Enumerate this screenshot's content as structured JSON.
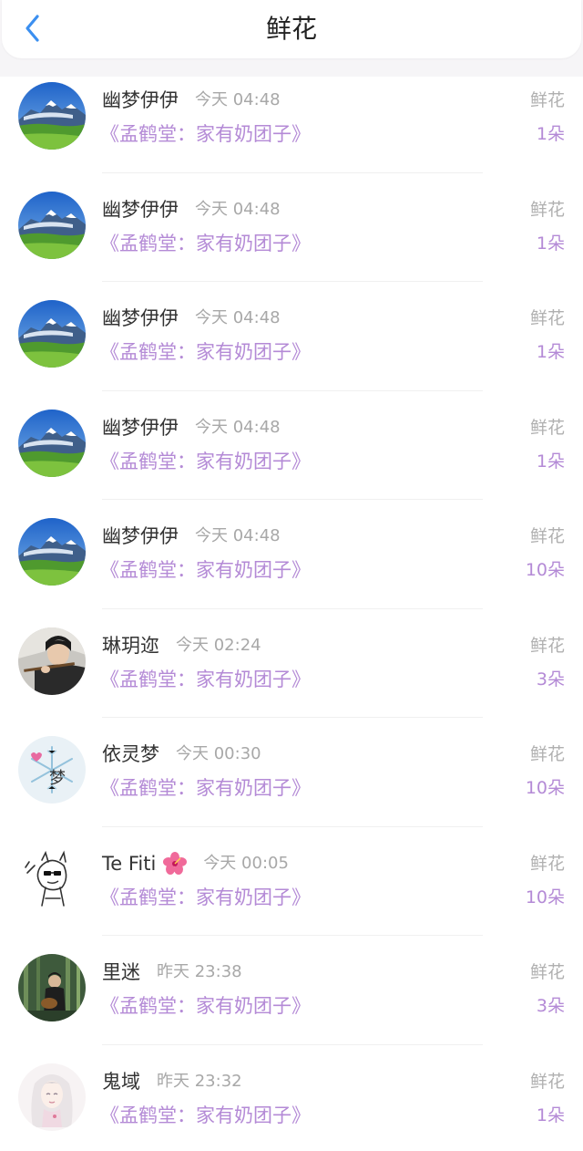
{
  "header": {
    "title": "鲜花",
    "back_icon": "chevron-left-icon",
    "accent_color": "#3b8ff0"
  },
  "colors": {
    "book_title": "#b48ad6",
    "count": "#b48ad6",
    "muted": "#a8a8a8"
  },
  "records": [
    {
      "name": "幽梦伊伊",
      "time": "今天 04:48",
      "book": "《孟鹤堂：家有奶团子》",
      "gift_type": "鲜花",
      "count": "1朵",
      "avatar": "mountain-landscape-avatar"
    },
    {
      "name": "幽梦伊伊",
      "time": "今天 04:48",
      "book": "《孟鹤堂：家有奶团子》",
      "gift_type": "鲜花",
      "count": "1朵",
      "avatar": "mountain-landscape-avatar"
    },
    {
      "name": "幽梦伊伊",
      "time": "今天 04:48",
      "book": "《孟鹤堂：家有奶团子》",
      "gift_type": "鲜花",
      "count": "1朵",
      "avatar": "mountain-landscape-avatar"
    },
    {
      "name": "幽梦伊伊",
      "time": "今天 04:48",
      "book": "《孟鹤堂：家有奶团子》",
      "gift_type": "鲜花",
      "count": "1朵",
      "avatar": "mountain-landscape-avatar"
    },
    {
      "name": "幽梦伊伊",
      "time": "今天 04:48",
      "book": "《孟鹤堂：家有奶团子》",
      "gift_type": "鲜花",
      "count": "10朵",
      "avatar": "mountain-landscape-avatar"
    },
    {
      "name": "琳玥迩",
      "time": "今天 02:24",
      "book": "《孟鹤堂：家有奶团子》",
      "gift_type": "鲜花",
      "count": "3朵",
      "avatar": "flute-player-avatar"
    },
    {
      "name": "依灵梦",
      "time": "今天 00:30",
      "book": "《孟鹤堂：家有奶团子》",
      "gift_type": "鲜花",
      "count": "10朵",
      "avatar": "snowflake-dream-avatar"
    },
    {
      "name": "Te Fiti",
      "time": "今天 00:05",
      "book": "《孟鹤堂：家有奶团子》",
      "gift_type": "鲜花",
      "count": "10朵",
      "avatar": "sketch-character-avatar",
      "name_icon": "hibiscus-flower-icon"
    },
    {
      "name": "里迷",
      "time": "昨天 23:38",
      "book": "《孟鹤堂：家有奶团子》",
      "gift_type": "鲜花",
      "count": "3朵",
      "avatar": "forest-musician-avatar"
    },
    {
      "name": "鬼域",
      "time": "昨天 23:32",
      "book": "《孟鹤堂：家有奶团子》",
      "gift_type": "鲜花",
      "count": "1朵",
      "avatar": "white-hair-girl-avatar"
    }
  ]
}
